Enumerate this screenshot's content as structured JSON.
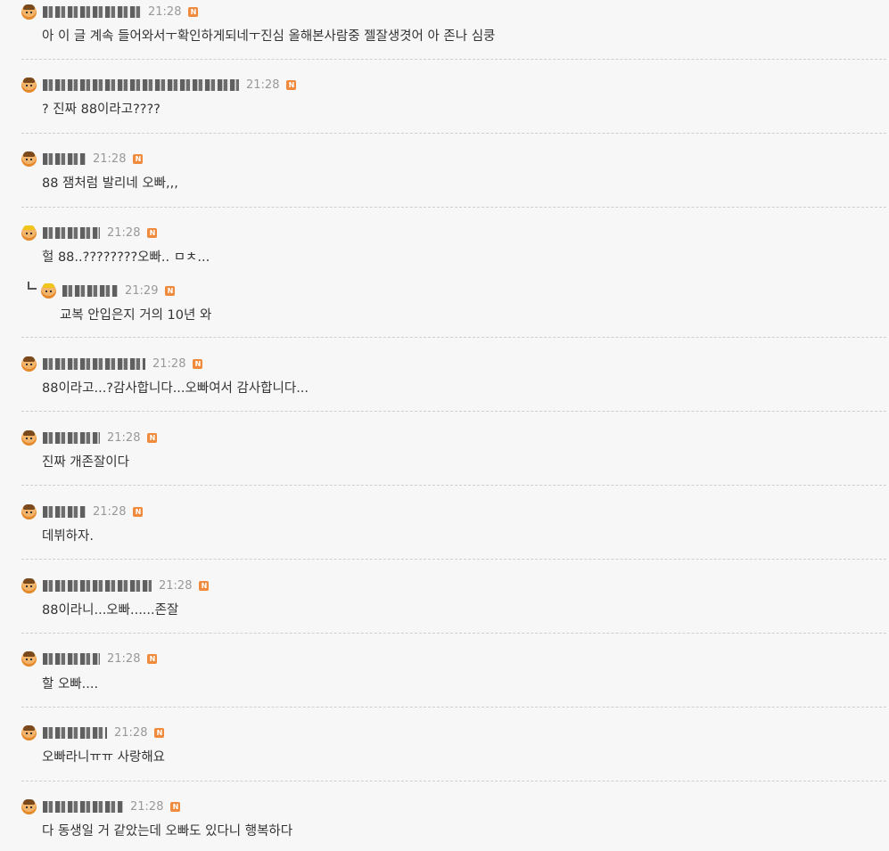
{
  "comments": [
    {
      "time": "21:28",
      "badge": "N",
      "text": "아 이 글 계속 들어와서ㅜ확인하게되네ㅜ진심 올해본사람중 젤잘생겻어 아 존나 심쿵",
      "avatar": "boy-avatar-icon"
    },
    {
      "time": "21:28",
      "badge": "N",
      "text": "? 진짜 88이라고????",
      "avatar": "boy-avatar-icon"
    },
    {
      "time": "21:28",
      "badge": "N",
      "text": "88 잼처럼 발리네 오빠,,,",
      "avatar": "boy-avatar-icon"
    },
    {
      "time": "21:28",
      "badge": "N",
      "text": "헐 88..????????오빠.. ㅁㅊ...",
      "avatar": "gold-avatar-icon",
      "reply": {
        "time": "21:29",
        "badge": "N",
        "text": "교복 안입은지 거의 10년 와",
        "avatar": "gold-avatar-icon"
      }
    },
    {
      "time": "21:28",
      "badge": "N",
      "text": "88이라고...?감사합니다...오빠여서 감사합니다...",
      "avatar": "boy-avatar-icon"
    },
    {
      "time": "21:28",
      "badge": "N",
      "text": "진짜 개존잘이다",
      "avatar": "boy-avatar-icon"
    },
    {
      "time": "21:28",
      "badge": "N",
      "text": "데뷔하자.",
      "avatar": "boy-avatar-icon"
    },
    {
      "time": "21:28",
      "badge": "N",
      "text": "88이라니...오빠......존잘",
      "avatar": "boy-avatar-icon"
    },
    {
      "time": "21:28",
      "badge": "N",
      "text": "할 오빠....",
      "avatar": "boy-avatar-icon"
    },
    {
      "time": "21:28",
      "badge": "N",
      "text": "오빠라니ㅠㅠ 사랑해요",
      "avatar": "boy-avatar-icon"
    },
    {
      "time": "21:28",
      "badge": "N",
      "text": "다 동생일 거 같았는데 오빠도 있다니 행복하다",
      "avatar": "boy-avatar-icon"
    }
  ]
}
